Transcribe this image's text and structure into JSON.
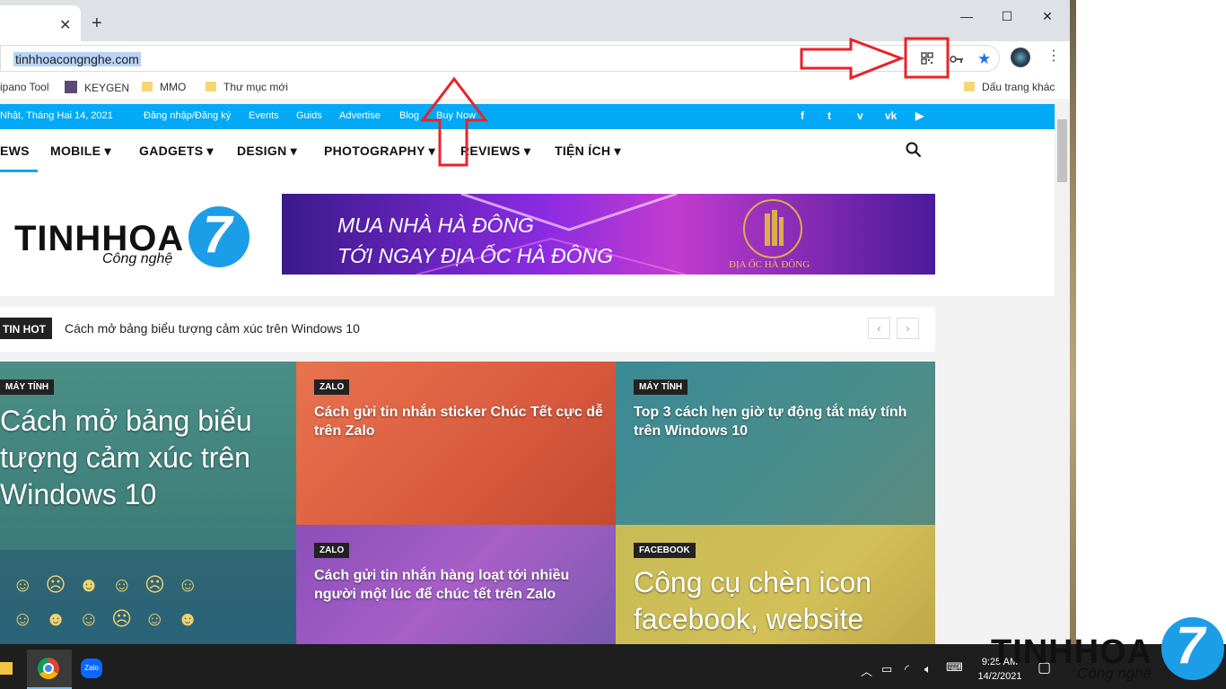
{
  "browser": {
    "url": "tinhhoacongnghe.com",
    "new_tab": "+",
    "tab_close": "✕",
    "window_controls": {
      "minimize": "—",
      "maximize": "☐",
      "close": "✕"
    },
    "bookmarks": {
      "items": [
        "ipano Tool",
        "KEYGEN",
        "MMO",
        "Thư mục mới"
      ],
      "other": "Dấu trang khác"
    }
  },
  "site": {
    "topbar": {
      "date": "Nhật, Tháng Hai 14, 2021",
      "links": [
        "Đăng nhập/Đăng ký",
        "Events",
        "Guids",
        "Advertise",
        "Blog",
        "Buy Now"
      ],
      "social": [
        "f",
        "t",
        "v",
        "vk",
        "▶"
      ]
    },
    "menu": {
      "first": "EWS",
      "items": [
        "MOBILE",
        "GADGETS",
        "DESIGN",
        "PHOTOGRAPHY",
        "REVIEWS",
        "TIỆN ÍCH"
      ]
    },
    "logo": {
      "main": "TINHHOA",
      "sub": "Công nghệ",
      "mark": "7"
    },
    "banner": {
      "line1": "MUA NHÀ HÀ ĐÔNG",
      "line2": "TỚI NGAY ĐỊA ỐC HÀ ĐÔNG",
      "caption": "ĐỊA ỐC HÀ ĐÔNG"
    },
    "news": {
      "label": "TIN HOT",
      "ticker": "Cách mở bảng biểu tượng cảm xúc trên Windows 10",
      "prev": "‹",
      "next": "›"
    },
    "tiles": [
      {
        "category": "MÁY TÍNH",
        "title": "Cách mở bảng biểu tượng cảm xúc trên Windows 10"
      },
      {
        "category": "ZALO",
        "title": "Cách gửi tin nhắn sticker Chúc Tết cực dễ trên Zalo"
      },
      {
        "category": "MÁY TÍNH",
        "title": "Top 3 cách hẹn giờ tự động tắt máy tính trên Windows 10"
      },
      {
        "category": "ZALO",
        "title": "Cách gửi tin nhắn hàng loạt tới nhiều người một lúc để chúc tết trên Zalo"
      },
      {
        "category": "FACEBOOK",
        "title": "Công cụ chèn icon facebook, website"
      }
    ]
  },
  "taskbar": {
    "zalo_label": "Zalo",
    "time": "9:25 AM",
    "date": "14/2/2021"
  },
  "watermark": {
    "main": "TINHHOA",
    "sub": "Công nghệ",
    "mark": "7"
  },
  "colors": {
    "accent": "#03a9f4",
    "annotation": "#e8232a",
    "logo_blue": "#1c9de8"
  }
}
